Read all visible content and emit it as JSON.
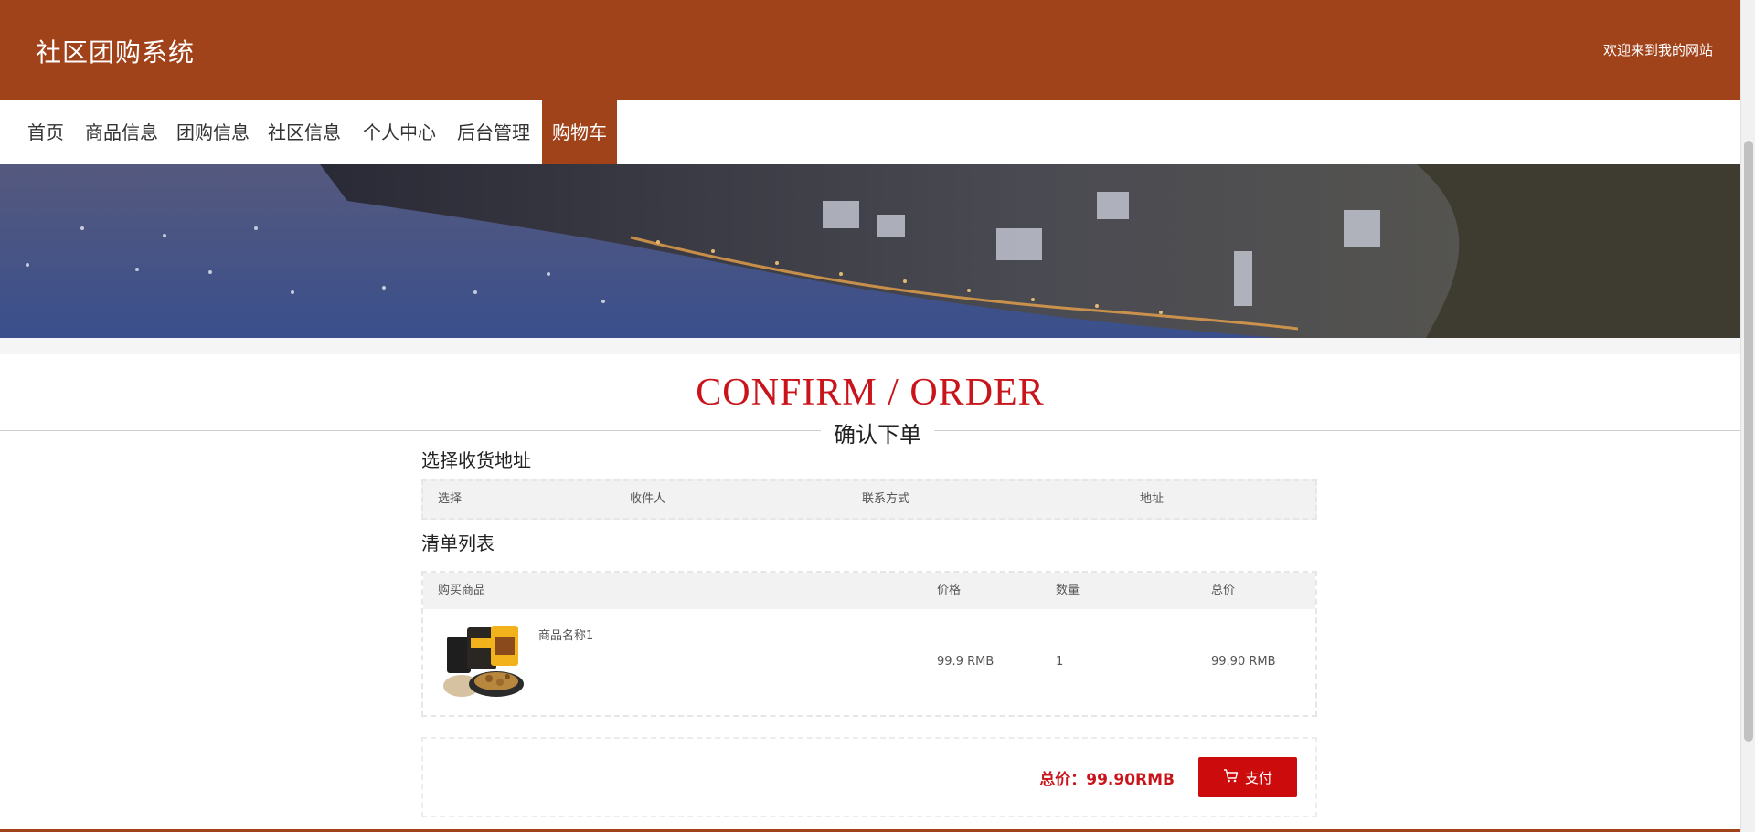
{
  "header": {
    "site_title": "社区团购系统",
    "welcome": "欢迎来到我的网站"
  },
  "nav": {
    "items": [
      {
        "label": "首页"
      },
      {
        "label": "商品信息"
      },
      {
        "label": "团购信息"
      },
      {
        "label": "社区信息"
      },
      {
        "label": "个人中心"
      },
      {
        "label": "后台管理"
      },
      {
        "label": "购物车",
        "active": true
      }
    ]
  },
  "section": {
    "title_en": "CONFIRM / ORDER",
    "title_cn": "确认下单"
  },
  "address": {
    "heading": "选择收货地址",
    "columns": [
      "选择",
      "收件人",
      "联系方式",
      "地址"
    ]
  },
  "order_list": {
    "heading": "清单列表",
    "columns": [
      "购买商品",
      "价格",
      "数量",
      "总价"
    ],
    "rows": [
      {
        "product_name": "商品名称1",
        "price": "99.9 RMB",
        "quantity": "1",
        "total": "99.90 RMB",
        "image_icon": "snack-package-image"
      }
    ]
  },
  "summary": {
    "total_label": "总价：99.90RMB",
    "pay_label": "支付"
  },
  "colors": {
    "brand": "#a0421a",
    "accent_red": "#cc0c0c",
    "title_red": "#c8141a"
  }
}
